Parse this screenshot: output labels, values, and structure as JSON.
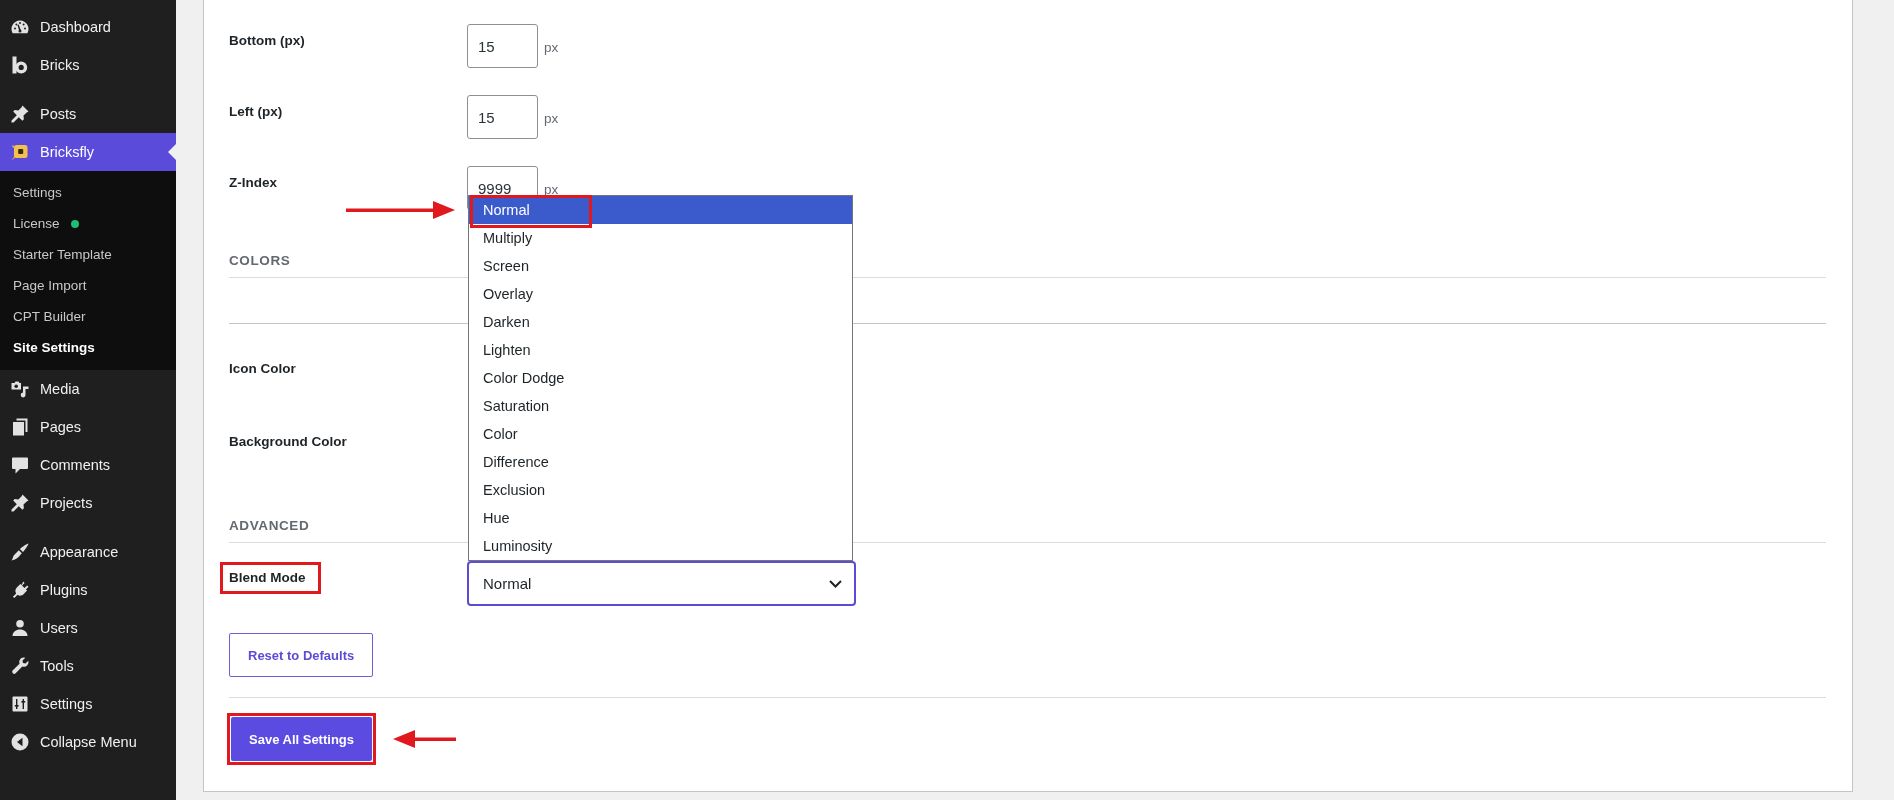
{
  "sidebar": {
    "groups": [
      {
        "items": [
          {
            "label": "Dashboard",
            "selected": false
          },
          {
            "label": "Bricks",
            "selected": false
          }
        ]
      },
      {
        "items": [
          {
            "label": "Posts",
            "selected": false
          },
          {
            "label": "Bricksfly",
            "selected": true,
            "children": [
              {
                "label": "Settings",
                "selected": false
              },
              {
                "label": "License",
                "selected": false,
                "color": "#1fbf75"
              },
              {
                "label": "Starter Template",
                "selected": false
              },
              {
                "label": "Page Import",
                "selected": false
              },
              {
                "label": "CPT Builder",
                "selected": false
              },
              {
                "label": "Site Settings",
                "selected": true
              }
            ]
          },
          {
            "label": "Media",
            "selected": false
          },
          {
            "label": "Pages",
            "selected": false
          },
          {
            "label": "Comments",
            "selected": false
          },
          {
            "label": "Projects",
            "selected": false
          }
        ]
      },
      {
        "items": [
          {
            "label": "Appearance",
            "selected": false
          },
          {
            "label": "Plugins",
            "selected": false
          },
          {
            "label": "Users",
            "selected": false
          },
          {
            "label": "Tools",
            "selected": false
          },
          {
            "label": "Settings",
            "selected": false
          },
          {
            "label": "Collapse Menu",
            "selected": false
          }
        ]
      }
    ]
  },
  "form": {
    "sections": [
      {
        "rows": [
          {
            "kind": "number",
            "label": "Bottom (px)",
            "value": "15",
            "unit": "px",
            "marked": false
          },
          {
            "kind": "number",
            "label": "Left (px)",
            "value": "15",
            "unit": "px",
            "marked": false
          },
          {
            "kind": "number",
            "label": "Z-Index",
            "value": "9999",
            "unit": "px",
            "marked": false
          }
        ]
      },
      {
        "heading": "COLORS",
        "rows": [
          {
            "kind": "color",
            "label": "Icon Color",
            "marked": false
          },
          {
            "kind": "color",
            "label": "Background Color",
            "marked": false
          }
        ]
      },
      {
        "heading": "ADVANCED",
        "rows": [
          {
            "kind": "select",
            "label": "Blend Mode",
            "value": "Normal",
            "marked": true,
            "expanded": true,
            "options": [
              {
                "label": "Normal",
                "selected": true,
                "marked": true,
                "arrow": true
              },
              {
                "label": "Multiply",
                "selected": false,
                "marked": false,
                "arrow": false
              },
              {
                "label": "Screen",
                "selected": false,
                "marked": false,
                "arrow": false
              },
              {
                "label": "Overlay",
                "selected": false,
                "marked": false,
                "arrow": false
              },
              {
                "label": "Darken",
                "selected": false,
                "marked": false,
                "arrow": false
              },
              {
                "label": "Lighten",
                "selected": false,
                "marked": false,
                "arrow": false
              },
              {
                "label": "Color Dodge",
                "selected": false,
                "marked": false,
                "arrow": false
              },
              {
                "label": "Saturation",
                "selected": false,
                "marked": false,
                "arrow": false
              },
              {
                "label": "Color",
                "selected": false,
                "marked": false,
                "arrow": false
              },
              {
                "label": "Difference",
                "selected": false,
                "marked": false,
                "arrow": false
              },
              {
                "label": "Exclusion",
                "selected": false,
                "marked": false,
                "arrow": false
              },
              {
                "label": "Hue",
                "selected": false,
                "marked": false,
                "arrow": false
              },
              {
                "label": "Luminosity",
                "selected": false,
                "marked": false,
                "arrow": false
              }
            ]
          }
        ]
      }
    ]
  },
  "reset_button": {
    "label": "Reset to Defaults",
    "marked": false,
    "arrow": false
  },
  "save_button": {
    "label": "Save All Settings",
    "marked": true,
    "arrow": true
  }
}
